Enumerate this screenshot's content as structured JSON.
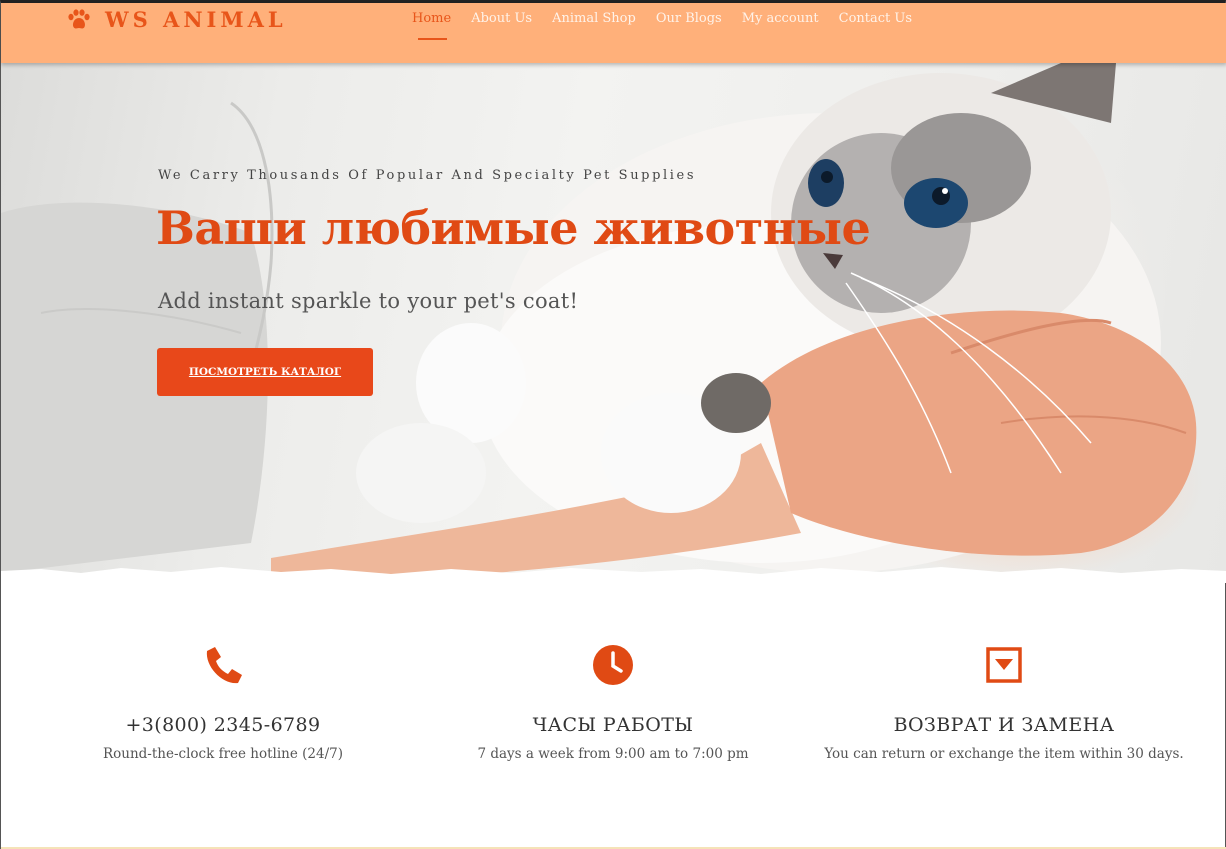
{
  "header": {
    "logo_text": "WS ANIMAL",
    "logo_icon": "paw-icon",
    "nav": [
      {
        "label": "Home",
        "active": true
      },
      {
        "label": "About Us",
        "active": false
      },
      {
        "label": "Animal Shop",
        "active": false
      },
      {
        "label": "Our Blogs",
        "active": false
      },
      {
        "label": "My account",
        "active": false
      },
      {
        "label": "Contact Us",
        "active": false
      }
    ]
  },
  "hero": {
    "subtitle": "We Carry Thousands Of Popular And Specialty Pet Supplies",
    "title": "Ваши любимые животные",
    "description": "Add instant sparkle to your pet's coat!",
    "button_label": "ПОСМОТРЕТЬ КАТАЛОГ",
    "image": "cat-in-hands-photo"
  },
  "features": [
    {
      "icon": "phone-icon",
      "title": "+3(800) 2345-6789",
      "description": "Round-the-clock free hotline (24/7)"
    },
    {
      "icon": "clock-icon",
      "title": "ЧАСЫ РАБОТЫ",
      "description": "7 days a week from 9:00 am to 7:00 pm"
    },
    {
      "icon": "return-box-icon",
      "title": "ВОЗВРАТ И ЗАМЕНА",
      "description": "You can return or exchange the item within 30 days."
    }
  ],
  "colors": {
    "header_bg": "#ffb07a",
    "accent": "#e8481a",
    "title": "#e04a14"
  }
}
